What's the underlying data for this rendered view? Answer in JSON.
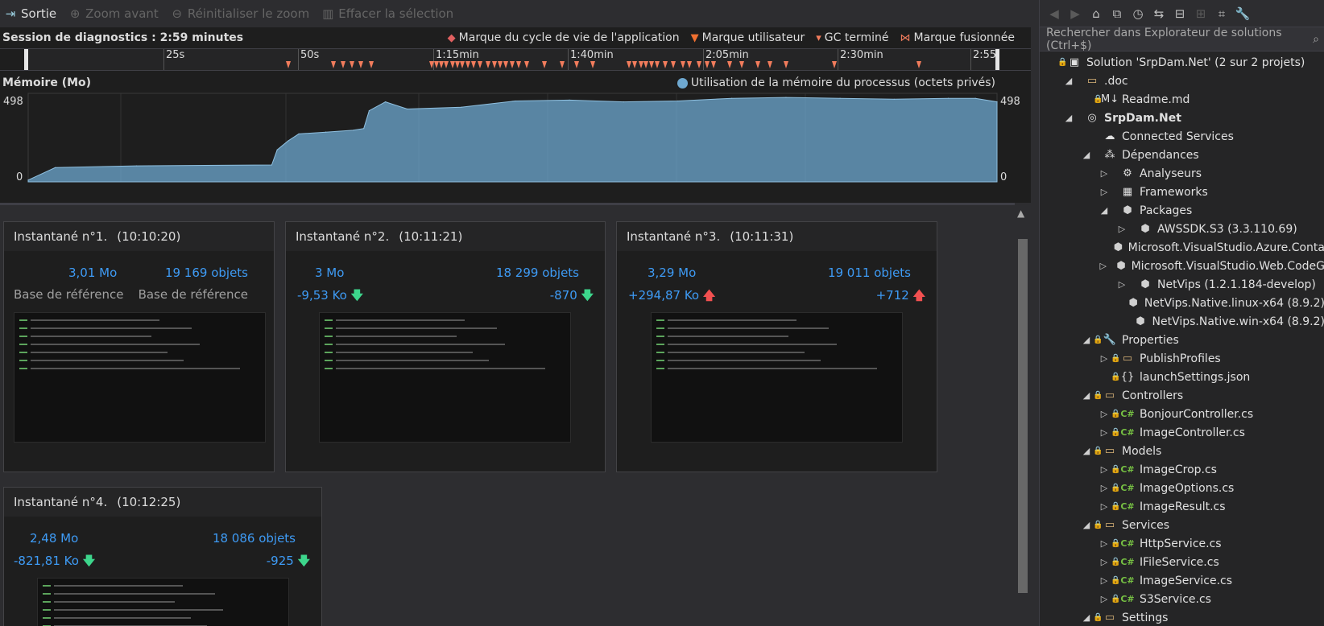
{
  "toolbar": {
    "exit_label": "Sortie",
    "zoom_in_label": "Zoom avant",
    "reset_zoom_label": "Réinitialiser le zoom",
    "clear_selection_label": "Effacer la sélection"
  },
  "session": {
    "label": "Session de diagnostics : 2:59 minutes",
    "legend": {
      "lifecycle": "Marque du cycle de vie de l'application",
      "user": "Marque utilisateur",
      "gc": "GC terminé",
      "merged": "Marque fusionnée"
    }
  },
  "timeline": {
    "ticks": [
      "25s",
      "50s",
      "1:15min",
      "1:40min",
      "2:05min",
      "2:30min",
      "2:55"
    ]
  },
  "memory": {
    "title": "Mémoire (Mo)",
    "legend": "Utilisation de la mémoire du processus (octets privés)",
    "ymax_left": "498",
    "ymin_left": "0",
    "ymax_right": "498",
    "ymin_right": "0",
    "color": "#6ea8d0"
  },
  "chart_data": {
    "type": "area",
    "title": "Mémoire (Mo)",
    "xlabel": "",
    "ylabel": "Mo",
    "ylim": [
      0,
      498
    ],
    "x": [
      0,
      5,
      20,
      45,
      46,
      48,
      50,
      55,
      60,
      62,
      63,
      66,
      70,
      80,
      90,
      100,
      110,
      120,
      130,
      140,
      150,
      160,
      170,
      175,
      179
    ],
    "series": [
      {
        "values": [
          10,
          80,
          90,
          95,
          180,
          230,
          270,
          280,
          290,
          300,
          400,
          450,
          410,
          420,
          455,
          460,
          450,
          455,
          470,
          475,
          470,
          465,
          470,
          470,
          450
        ]
      }
    ]
  },
  "snapshots": [
    {
      "title": "Instantané n°1.",
      "time": "(10:10:20)",
      "size": "3,01 Mo",
      "objects": "19 169 objets",
      "size_delta": "Base de référence",
      "obj_delta": "Base de référence",
      "trend": "none"
    },
    {
      "title": "Instantané n°2.",
      "time": "(10:11:21)",
      "size": "3 Mo",
      "objects": "18 299 objets",
      "size_delta": "-9,53 Ko",
      "obj_delta": "-870",
      "trend": "down"
    },
    {
      "title": "Instantané n°3.",
      "time": "(10:11:31)",
      "size": "3,29 Mo",
      "objects": "19 011 objets",
      "size_delta": "+294,87 Ko",
      "obj_delta": "+712",
      "trend": "up"
    },
    {
      "title": "Instantané n°4.",
      "time": "(10:12:25)",
      "size": "2,48 Mo",
      "objects": "18 086 objets",
      "size_delta": "-821,81 Ko",
      "obj_delta": "-925",
      "trend": "down"
    }
  ],
  "solution": {
    "search_placeholder": "Rechercher dans Explorateur de solutions (Ctrl+$)",
    "tree": [
      {
        "label": "Solution 'SrpDam.Net' (2 sur 2 projets)",
        "depth": 0,
        "exp": "",
        "icon": "solution-icon",
        "lock": true
      },
      {
        "label": ".doc",
        "depth": 1,
        "exp": "open",
        "icon": "folder-icon",
        "lock": false
      },
      {
        "label": "Readme.md",
        "depth": 2,
        "exp": "",
        "icon": "markdown-icon",
        "lock": true
      },
      {
        "label": "SrpDam.Net",
        "depth": 1,
        "exp": "open",
        "icon": "web-project-icon",
        "lock": false,
        "bold": true
      },
      {
        "label": "Connected Services",
        "depth": 2,
        "exp": "",
        "icon": "cloud-icon",
        "lock": false
      },
      {
        "label": "Dépendances",
        "depth": 2,
        "exp": "open",
        "icon": "dependencies-icon",
        "lock": false
      },
      {
        "label": "Analyseurs",
        "depth": 3,
        "exp": "closed",
        "icon": "analyzer-icon",
        "lock": false
      },
      {
        "label": "Frameworks",
        "depth": 3,
        "exp": "closed",
        "icon": "framework-icon",
        "lock": false
      },
      {
        "label": "Packages",
        "depth": 3,
        "exp": "open",
        "icon": "package-icon",
        "lock": false
      },
      {
        "label": "AWSSDK.S3 (3.3.110.69)",
        "depth": 4,
        "exp": "closed",
        "icon": "package-icon",
        "lock": false
      },
      {
        "label": "Microsoft.VisualStudio.Azure.Conta",
        "depth": 4,
        "exp": "",
        "icon": "package-icon",
        "lock": false
      },
      {
        "label": "Microsoft.VisualStudio.Web.CodeG",
        "depth": 4,
        "exp": "closed",
        "icon": "package-icon",
        "lock": false
      },
      {
        "label": "NetVips (1.2.1.184-develop)",
        "depth": 4,
        "exp": "closed",
        "icon": "package-icon",
        "lock": false
      },
      {
        "label": "NetVips.Native.linux-x64 (8.9.2)",
        "depth": 4,
        "exp": "",
        "icon": "package-icon",
        "lock": false
      },
      {
        "label": "NetVips.Native.win-x64 (8.9.2)",
        "depth": 4,
        "exp": "",
        "icon": "package-icon",
        "lock": false
      },
      {
        "label": "Properties",
        "depth": 2,
        "exp": "open",
        "icon": "wrench-icon",
        "lock": true
      },
      {
        "label": "PublishProfiles",
        "depth": 3,
        "exp": "closed",
        "icon": "folder-icon",
        "lock": true
      },
      {
        "label": "launchSettings.json",
        "depth": 3,
        "exp": "",
        "icon": "json-icon",
        "lock": true
      },
      {
        "label": "Controllers",
        "depth": 2,
        "exp": "open",
        "icon": "folder-icon",
        "lock": true
      },
      {
        "label": "BonjourController.cs",
        "depth": 3,
        "exp": "closed",
        "icon": "csharp-icon",
        "lock": true
      },
      {
        "label": "ImageController.cs",
        "depth": 3,
        "exp": "closed",
        "icon": "csharp-icon",
        "lock": true
      },
      {
        "label": "Models",
        "depth": 2,
        "exp": "open",
        "icon": "folder-icon",
        "lock": true
      },
      {
        "label": "ImageCrop.cs",
        "depth": 3,
        "exp": "closed",
        "icon": "csharp-icon",
        "lock": true
      },
      {
        "label": "ImageOptions.cs",
        "depth": 3,
        "exp": "closed",
        "icon": "csharp-icon",
        "lock": true
      },
      {
        "label": "ImageResult.cs",
        "depth": 3,
        "exp": "closed",
        "icon": "csharp-icon",
        "lock": true
      },
      {
        "label": "Services",
        "depth": 2,
        "exp": "open",
        "icon": "folder-icon",
        "lock": true
      },
      {
        "label": "HttpService.cs",
        "depth": 3,
        "exp": "closed",
        "icon": "csharp-icon",
        "lock": true
      },
      {
        "label": "IFileService.cs",
        "depth": 3,
        "exp": "closed",
        "icon": "csharp-icon",
        "lock": true
      },
      {
        "label": "ImageService.cs",
        "depth": 3,
        "exp": "closed",
        "icon": "csharp-icon",
        "lock": true
      },
      {
        "label": "S3Service.cs",
        "depth": 3,
        "exp": "closed",
        "icon": "csharp-icon",
        "lock": true
      },
      {
        "label": "Settings",
        "depth": 2,
        "exp": "open",
        "icon": "folder-icon",
        "lock": true
      }
    ]
  }
}
